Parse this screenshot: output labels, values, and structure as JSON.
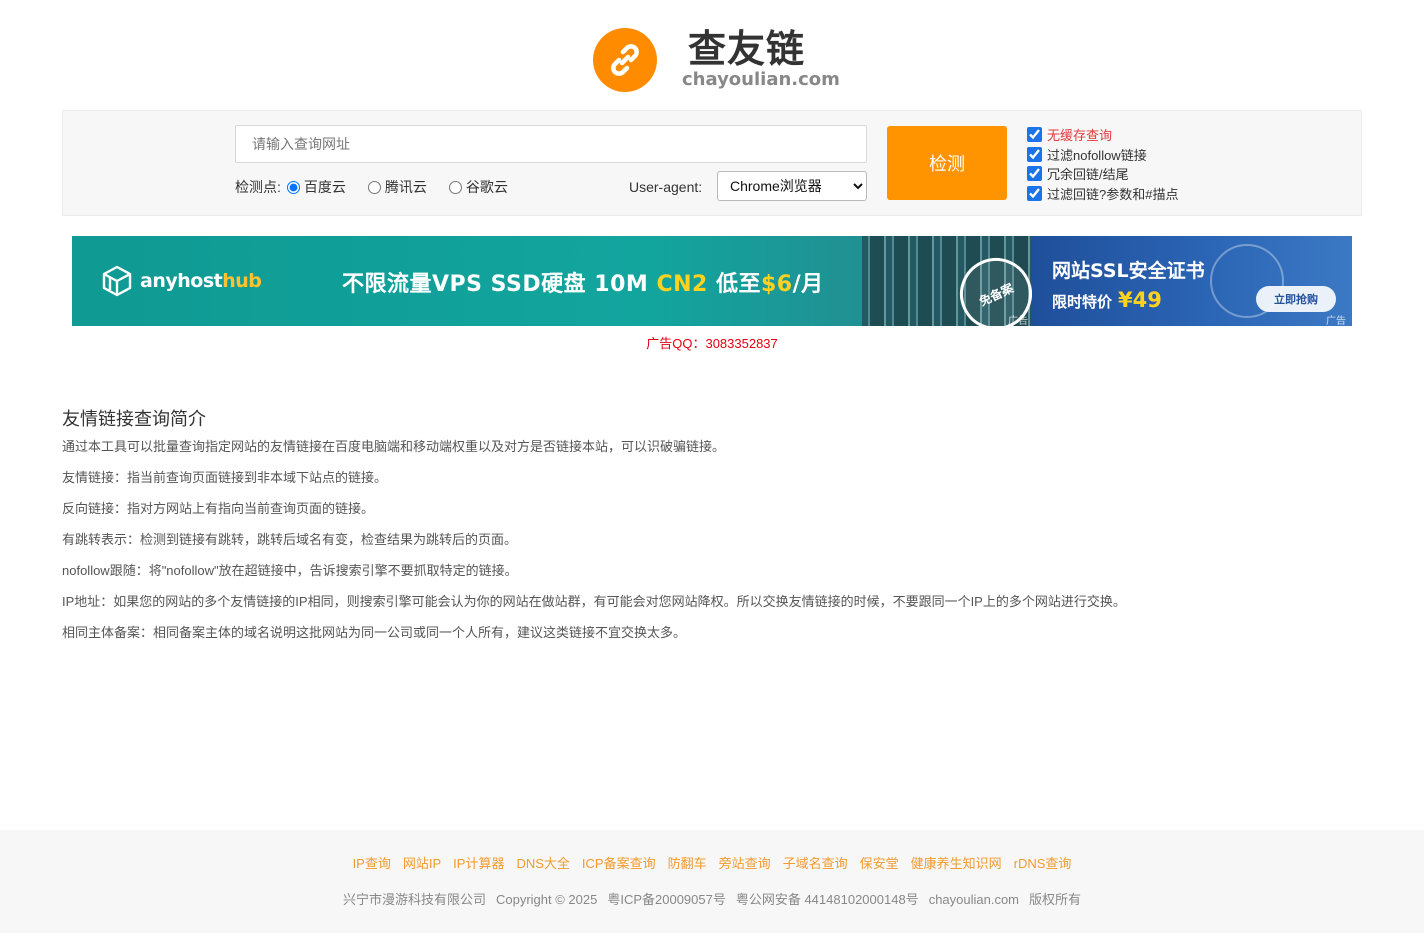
{
  "brand": {
    "title": "查友链",
    "domain": "chayoulian.com",
    "icon": "link-icon",
    "accent_color": "#ff8c00"
  },
  "search": {
    "placeholder": "请输入查询网址",
    "node_label": "检测点:",
    "nodes": [
      "百度云",
      "腾讯云",
      "谷歌云"
    ],
    "selected_node": "百度云",
    "ua_label": "User-agent:",
    "ua_selected": "Chrome浏览器",
    "submit_label": "检测",
    "options": [
      {
        "label": "无缓存查询",
        "checked": true,
        "highlight": true
      },
      {
        "label": "过滤nofollow链接",
        "checked": true
      },
      {
        "label": "冗余回链/结尾",
        "checked": true
      },
      {
        "label": "过滤回链?参数和#描点",
        "checked": true
      }
    ]
  },
  "banner": {
    "brand_main": "anyhost",
    "brand_accent": "hub",
    "slogan_a": "不限流量VPS SSD硬盘 10M ",
    "slogan_hl1": "CN2",
    "slogan_b": " 低至",
    "slogan_hl2": "$6",
    "slogan_c": "/月",
    "stamp": "免备案",
    "ad_tag": "广告",
    "ssl_title": "网站SSL安全证书",
    "ssl_price_label": "限时特价",
    "ssl_price": "¥49",
    "buy_label": "立即抢购"
  },
  "ad_contact": "广告QQ：3083352837",
  "intro": {
    "heading": "友情链接查询简介",
    "paragraphs": [
      "通过本工具可以批量查询指定网站的友情链接在百度电脑端和移动端权重以及对方是否链接本站，可以识破骗链接。",
      "友情链接：指当前查询页面链接到非本域下站点的链接。",
      "反向链接：指对方网站上有指向当前查询页面的链接。",
      "有跳转表示：检测到链接有跳转，跳转后域名有变，检查结果为跳转后的页面。",
      "nofollow跟随：将\"nofollow\"放在超链接中，告诉搜索引擎不要抓取特定的链接。",
      "IP地址：如果您的网站的多个友情链接的IP相同，则搜索引擎可能会认为你的网站在做站群，有可能会对您网站降权。所以交换友情链接的时候，不要跟同一个IP上的多个网站进行交换。",
      "相同主体备案：相同备案主体的域名说明这批网站为同一公司或同一个人所有，建议这类链接不宜交换太多。"
    ]
  },
  "footer": {
    "links": [
      "IP查询",
      "网站IP",
      "IP计算器",
      "DNS大全",
      "ICP备案查询",
      "防翻车",
      "旁站查询",
      "子域名查询",
      "保安堂",
      "健康养生知识网",
      "rDNS查询"
    ],
    "company": "兴宁市漫游科技有限公司",
    "copyright": "Copyright © 2025",
    "icp": "粤ICP备20009057号",
    "police": "粤公网安备 44148102000148号",
    "site": "chayoulian.com",
    "rights": "版权所有",
    "link_color": "#f29a2e"
  }
}
